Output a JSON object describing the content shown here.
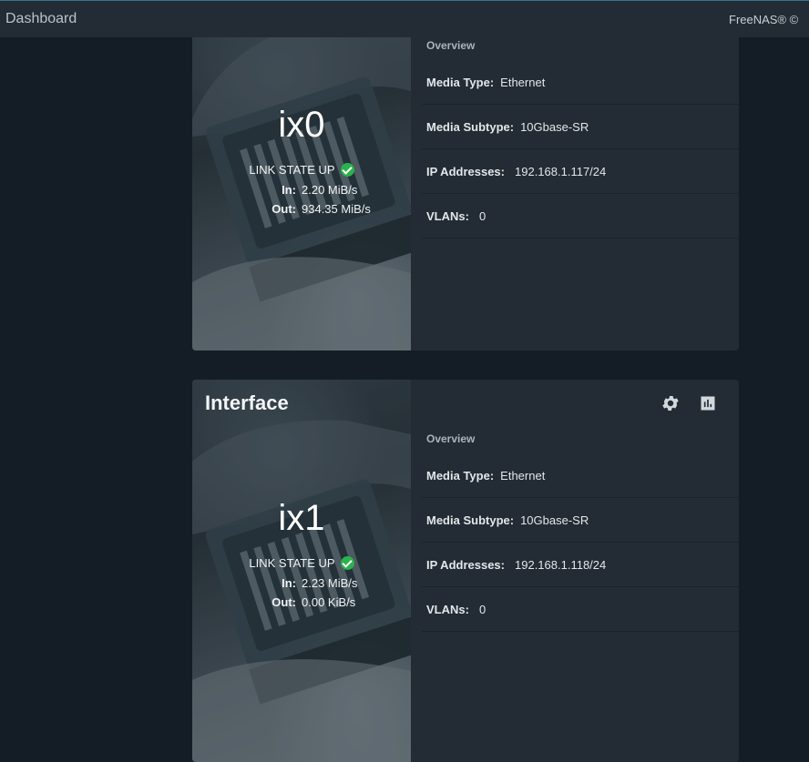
{
  "topbar": {
    "title": "Dashboard",
    "brand": "FreeNAS® ©"
  },
  "cards": [
    {
      "interface": "ix0",
      "link_state": "LINK STATE UP",
      "in_label": "In:",
      "in_value": "2.20 MiB/s",
      "out_label": "Out:",
      "out_value": "934.35 MiB/s",
      "overview_label": "Overview",
      "media_type_label": "Media Type:",
      "media_type": "Ethernet",
      "media_subtype_label": "Media Subtype:",
      "media_subtype": "10Gbase-SR",
      "ip_label": "IP Addresses:",
      "ip": "192.168.1.117/24",
      "vlans_label": "VLANs:",
      "vlans": "0"
    },
    {
      "title": "Interface",
      "interface": "ix1",
      "link_state": "LINK STATE UP",
      "in_label": "In:",
      "in_value": "2.23 MiB/s",
      "out_label": "Out:",
      "out_value": "0.00 KiB/s",
      "overview_label": "Overview",
      "media_type_label": "Media Type:",
      "media_type": "Ethernet",
      "media_subtype_label": "Media Subtype:",
      "media_subtype": "10Gbase-SR",
      "ip_label": "IP Addresses:",
      "ip": "192.168.1.118/24",
      "vlans_label": "VLANs:",
      "vlans": "0"
    }
  ],
  "icons": {
    "settings": "gear-icon",
    "reports": "bar-chart-icon",
    "status": "check-circle-icon"
  },
  "colors": {
    "background": "#141d26",
    "card": "#232c34",
    "status_ok": "#2bb24c"
  }
}
